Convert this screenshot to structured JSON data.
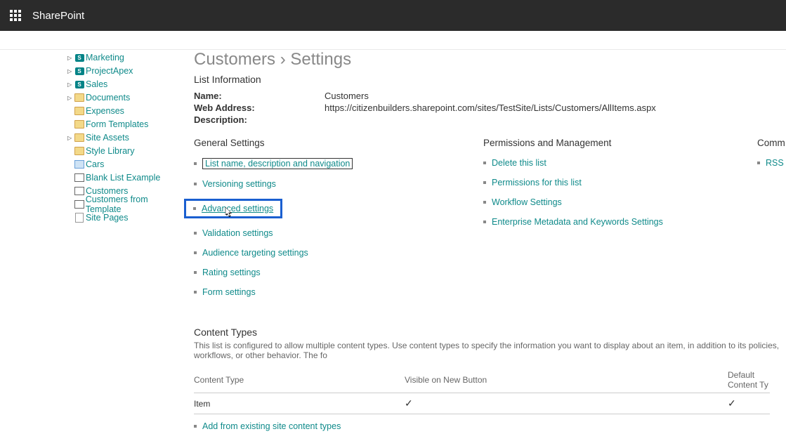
{
  "suite": {
    "brand": "SharePoint"
  },
  "sidebar": {
    "items": [
      {
        "label": "Marketing",
        "icon": "green",
        "expander": true
      },
      {
        "label": "ProjectApex",
        "icon": "green",
        "expander": true
      },
      {
        "label": "Sales",
        "icon": "green",
        "expander": true
      },
      {
        "label": "Documents",
        "icon": "folder",
        "expander": true
      },
      {
        "label": "Expenses",
        "icon": "folder",
        "expander": false
      },
      {
        "label": "Form Templates",
        "icon": "folder",
        "expander": false
      },
      {
        "label": "Site Assets",
        "icon": "folder",
        "expander": true
      },
      {
        "label": "Style Library",
        "icon": "folder",
        "expander": false
      },
      {
        "label": "Cars",
        "icon": "img",
        "expander": false
      },
      {
        "label": "Blank List Example",
        "icon": "list",
        "expander": false
      },
      {
        "label": "Customers",
        "icon": "list",
        "expander": false
      },
      {
        "label": "Customers from Template",
        "icon": "list",
        "expander": false
      },
      {
        "label": "Site Pages",
        "icon": "doc",
        "expander": false
      }
    ]
  },
  "page": {
    "title": "Customers › Settings",
    "list_info_heading": "List Information",
    "name_label": "Name:",
    "name_value": "Customers",
    "web_label": "Web Address:",
    "web_value": "https://citizenbuilders.sharepoint.com/sites/TestSite/Lists/Customers/AllItems.aspx",
    "desc_label": "Description:"
  },
  "general": {
    "heading": "General Settings",
    "links": [
      "List name, description and navigation",
      "Versioning settings",
      "Advanced settings",
      "Validation settings",
      "Audience targeting settings",
      "Rating settings",
      "Form settings"
    ]
  },
  "perms": {
    "heading": "Permissions and Management",
    "links": [
      "Delete this list",
      "Permissions for this list",
      "Workflow Settings",
      "Enterprise Metadata and Keywords Settings"
    ]
  },
  "comm": {
    "heading": "Comm",
    "links": [
      "RSS"
    ]
  },
  "ct": {
    "heading": "Content Types",
    "desc": "This list is configured to allow multiple content types. Use content types to specify the information you want to display about an item, in addition to its policies, workflows, or other behavior. The fo",
    "col1": "Content Type",
    "col2": "Visible on New Button",
    "col3": "Default Content Ty",
    "row1": "Item",
    "check": "✓",
    "addlink": "Add from existing site content types"
  }
}
